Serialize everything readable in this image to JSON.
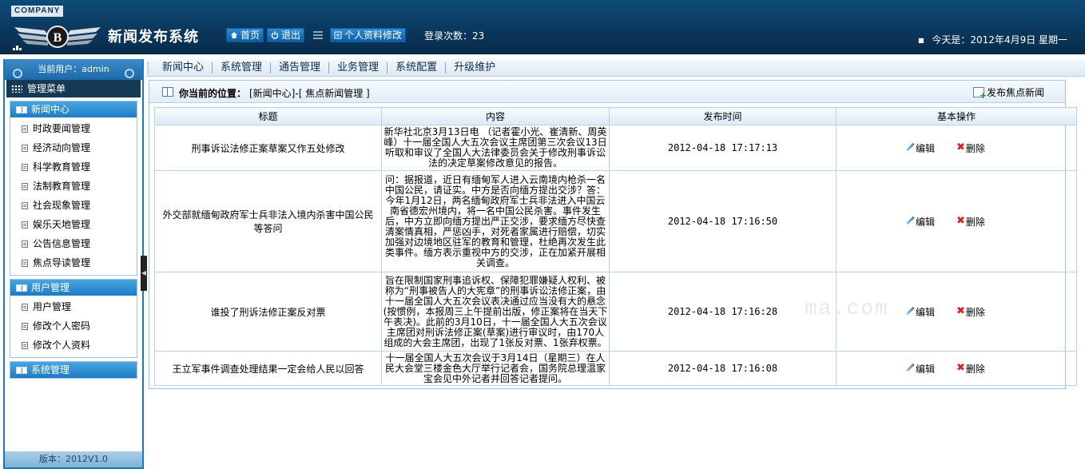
{
  "header": {
    "company": "COMPANY",
    "title": "新闻发布系统",
    "home_label": "首页",
    "logout_label": "退出",
    "profile_edit_label": "个人资料修改",
    "login_count_label": "登录次数：",
    "login_count": "23",
    "today_label": "今天是：",
    "today_value": "2012年4月9日 星期一",
    "colors": {
      "bg": "#0b3a60",
      "button": "#1d74be"
    }
  },
  "sidebar": {
    "current_user_label": "当前用户：",
    "current_user": "admin",
    "menu_title": "管理菜单",
    "groups": [
      {
        "title": "新闻中心",
        "items": [
          "时政要闻管理",
          "经济动向管理",
          "科学教育管理",
          "法制教育管理",
          "社会现象管理",
          "娱乐天地管理",
          "公告信息管理",
          "焦点导读管理"
        ]
      },
      {
        "title": "用户管理",
        "items": [
          "用户管理",
          "修改个人密码",
          "修改个人资料"
        ]
      },
      {
        "title": "系统管理",
        "items": []
      }
    ],
    "version_label": "版本：",
    "version": "2012V1.0"
  },
  "topnav": [
    "新闻中心",
    "系统管理",
    "通告管理",
    "业务管理",
    "系统配置",
    "升级维护"
  ],
  "location": {
    "label": "你当前的位置：",
    "path": "[新闻中心]-[ 焦点新闻管理 ]",
    "publish_label": "发布焦点新闻"
  },
  "table": {
    "headers": [
      "标题",
      "内容",
      "发布时间",
      "基本操作"
    ],
    "edit_label": "编辑",
    "delete_label": "删除",
    "rows": [
      {
        "title": "刑事诉讼法修正案草案又作五处修改",
        "content": "新华社北京3月13日电 （记者霍小光、崔清新、周英峰）十一届全国人大五次会议主席团第三次会议13日听取和审议了全国人大法律委员会关于修改刑事诉讼法的决定草案修改意见的报告。",
        "time": "2012-04-18 17:17:13"
      },
      {
        "title": "外交部就缅甸政府军士兵非法入境内杀害中国公民等答问",
        "content": "问：据报道，近日有缅甸军人进入云南境内枪杀一名中国公民，请证实。中方是否向缅方提出交涉？答：今年1月12日，两名缅甸政府军士兵非法进入中国云南省德宏州境内，将一名中国公民杀害。事件发生后，中方立即向缅方提出严正交涉，要求缅方尽快查清案情真相，严惩凶手，对死者家属进行赔偿，切实加强对边境地区驻军的教育和管理，杜绝再次发生此类事件。缅方表示重视中方的交涉，正在加紧开展相关调查。",
        "time": "2012-04-18 17:16:50"
      },
      {
        "title": "谁投了刑诉法修正案反对票",
        "content": "旨在限制国家刑事追诉权、保障犯罪嫌疑人权利、被称为“刑事被告人的大宪章”的刑事诉讼法修正案，由十一届全国人大五次会议表决通过应当没有大的悬念(按惯例，本报周三上午提前出版，修正案将在当天下午表决)。此前的3月10日，十一届全国人大五次会议主席团对刑诉法修正案(草案)进行审议时，由170人组成的大会主席团，出现了1张反对票、1张弃权票。",
        "time": "2012-04-18 17:16:28"
      },
      {
        "title": "王立军事件调查处理结果一定会给人民以回答",
        "content": "十一届全国人大五次会议于3月14日（星期三）在人民大会堂三楼金色大厅举行记者会，国务院总理温家宝会见中外记者并回答记者提问。",
        "time": "2012-04-18 17:16:08"
      }
    ]
  },
  "watermark": "ma.com"
}
